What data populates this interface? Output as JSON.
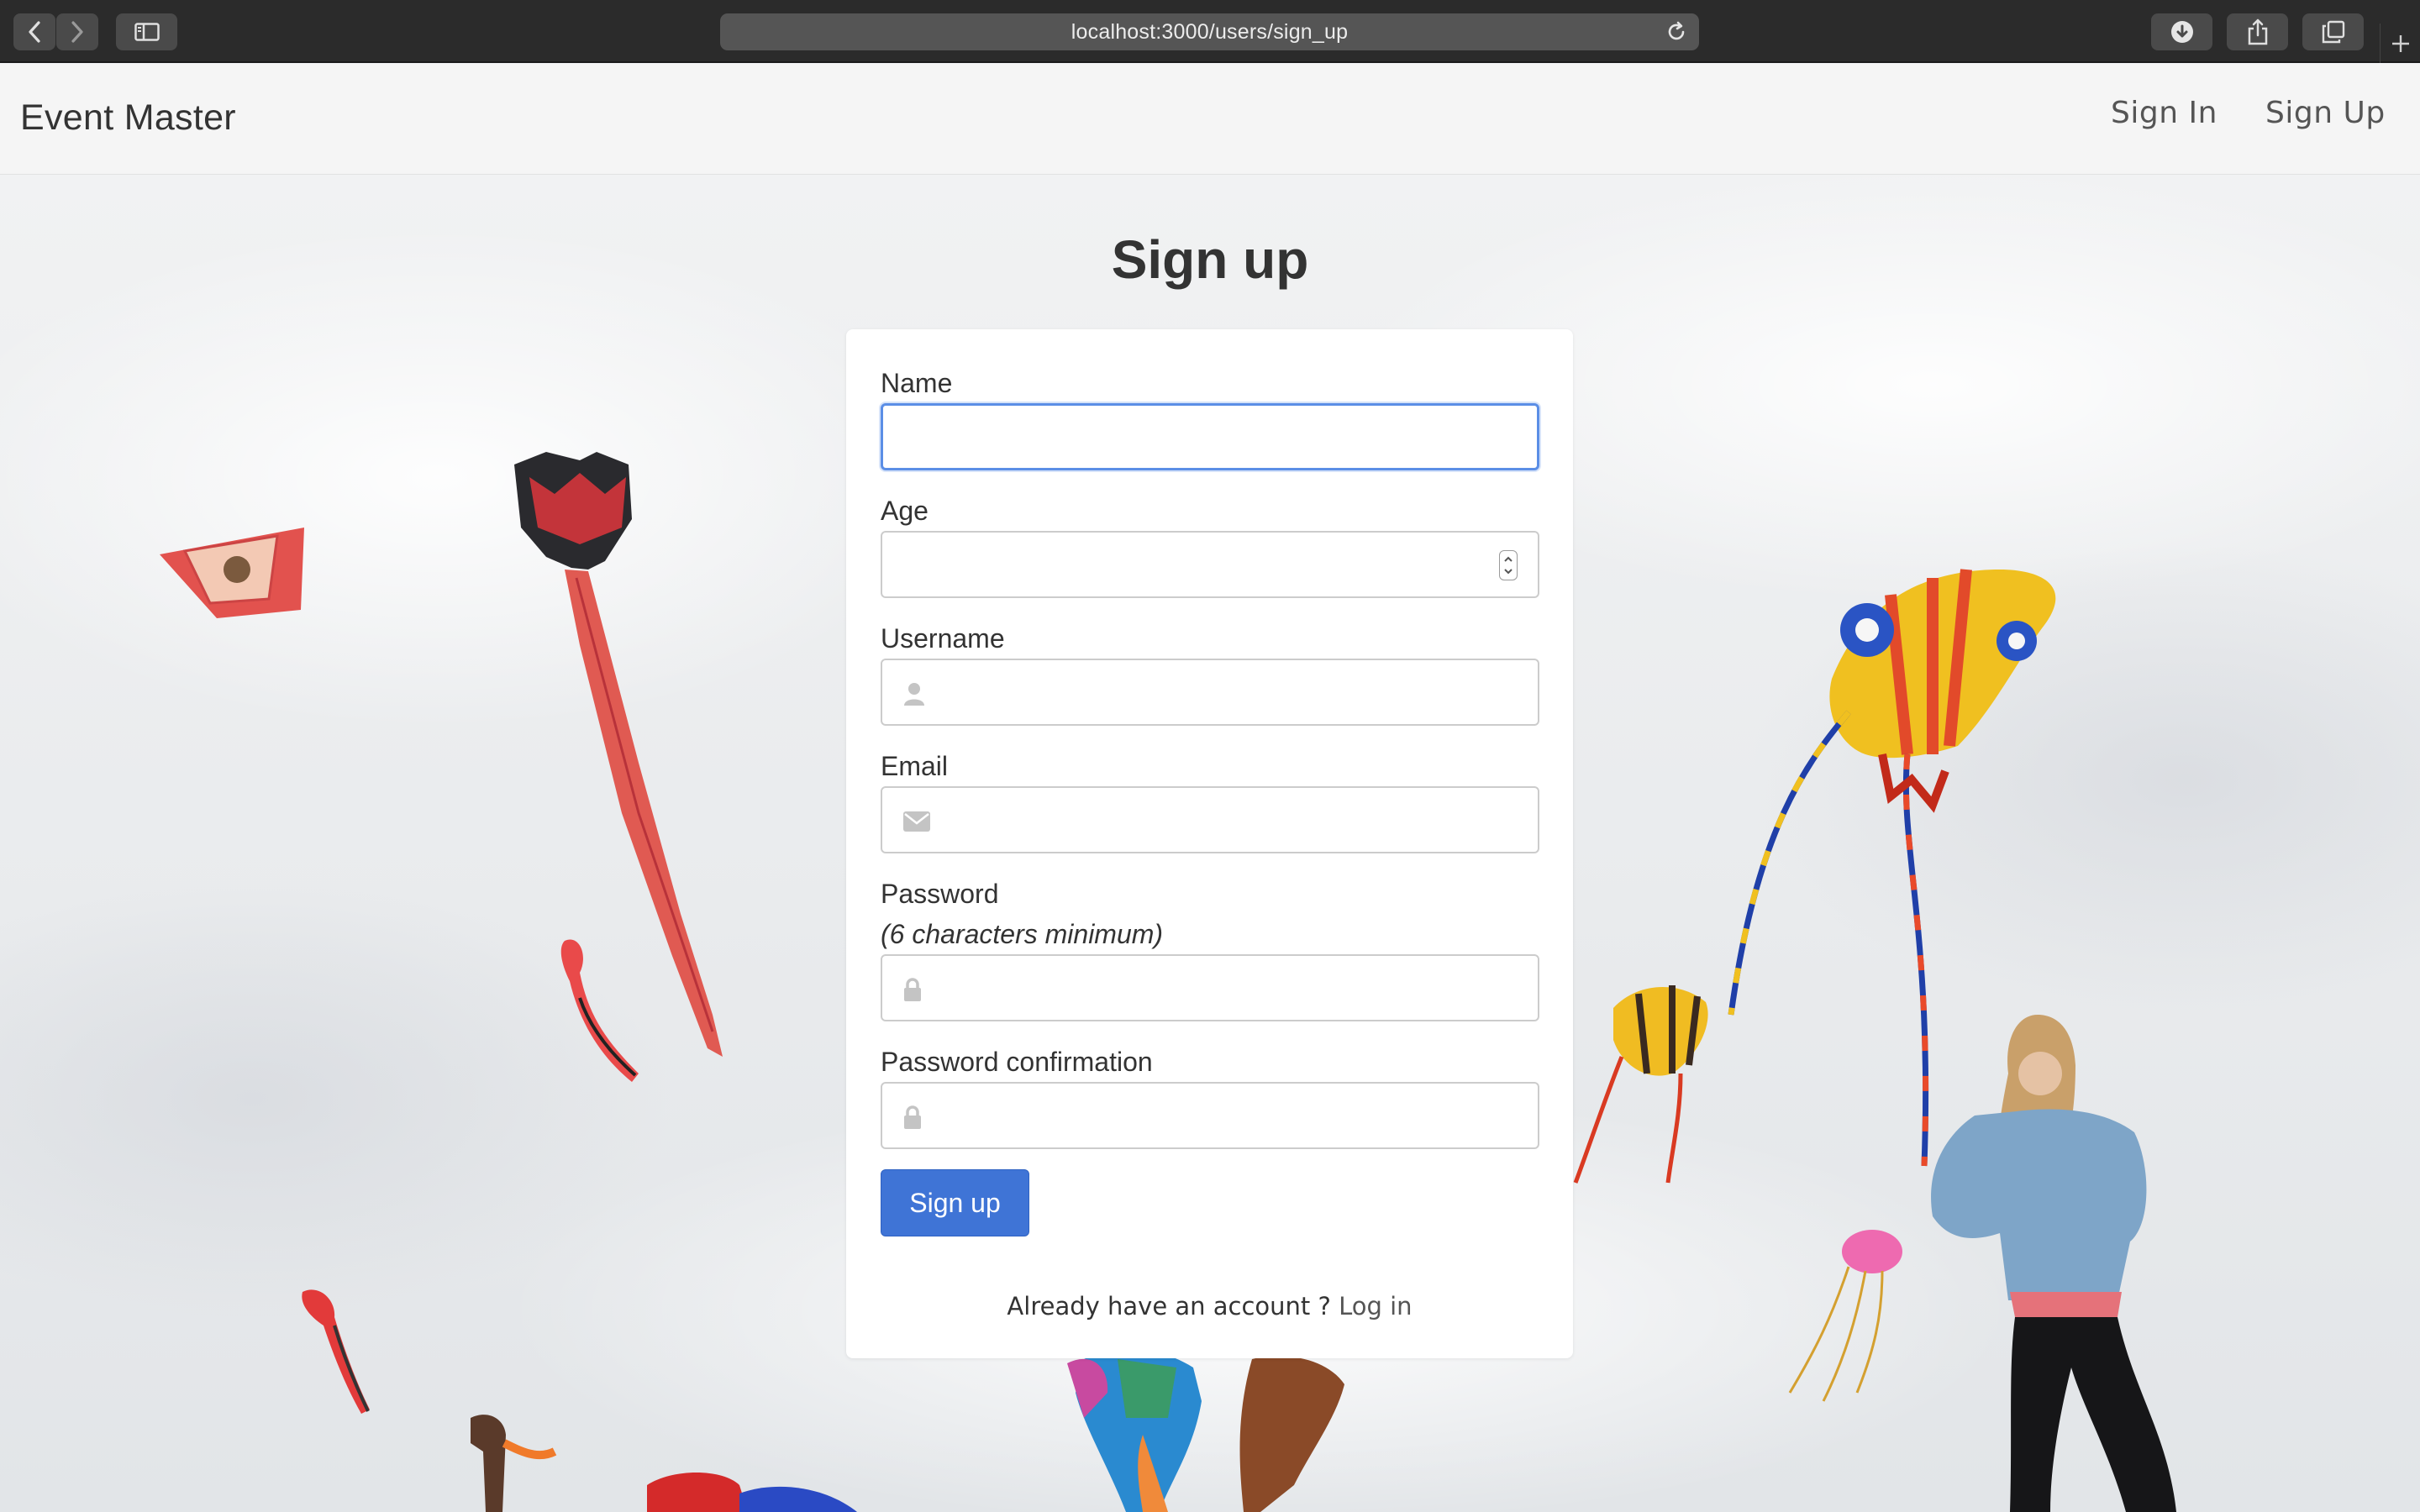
{
  "browser": {
    "url": "localhost:3000/users/sign_up"
  },
  "navbar": {
    "brand": "Event Master",
    "links": [
      {
        "label": "Sign In"
      },
      {
        "label": "Sign Up"
      }
    ]
  },
  "page": {
    "title": "Sign up"
  },
  "form": {
    "name_label": "Name",
    "name_value": "",
    "age_label": "Age",
    "age_value": "",
    "username_label": "Username",
    "username_value": "",
    "email_label": "Email",
    "email_value": "",
    "password_label": "Password",
    "password_hint": "(6 characters minimum)",
    "password_value": "",
    "password_confirmation_label": "Password confirmation",
    "password_confirmation_value": "",
    "submit_label": "Sign up",
    "footer_text": "Already have an account ? ",
    "login_link_label": "Log in"
  },
  "icons": {
    "username_field": "user-icon",
    "email_field": "envelope-icon",
    "password_field": "lock-icon",
    "password_confirmation_field": "lock-icon"
  },
  "colors": {
    "primary_button": "#3f74d6",
    "focus_border": "#5b8ee6",
    "navbar_bg": "#f5f5f5",
    "browser_chrome": "#2b2b2b"
  }
}
